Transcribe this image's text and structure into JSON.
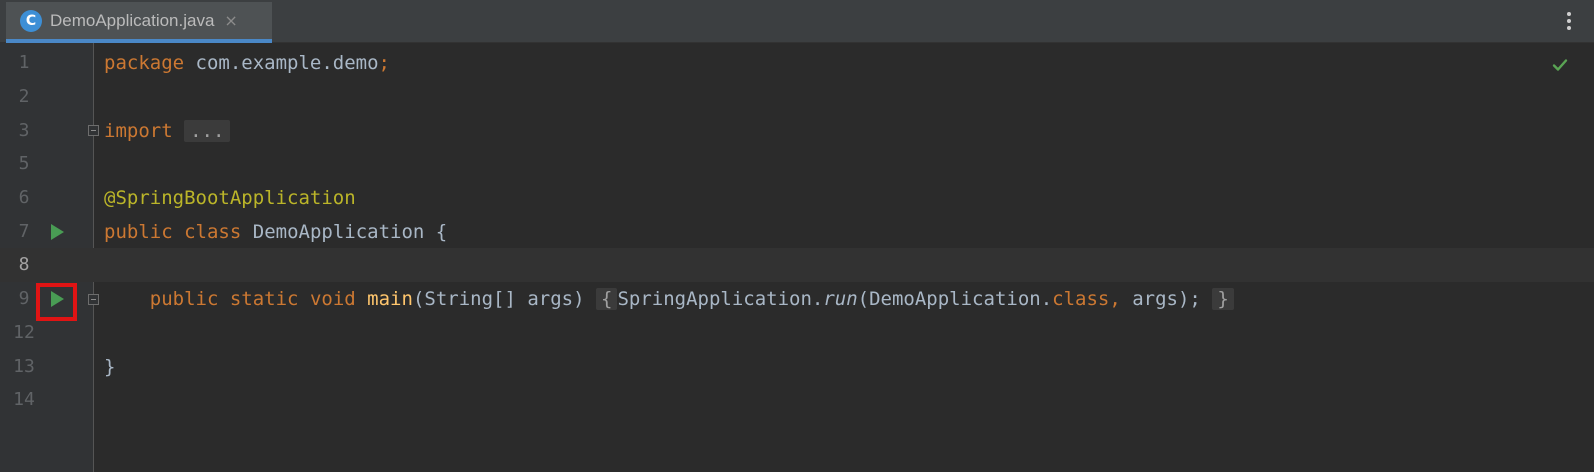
{
  "tab": {
    "title": "DemoApplication.java",
    "close_glyph": "×",
    "icon_letter": "C"
  },
  "lines": [
    {
      "number": "1",
      "active": false
    },
    {
      "number": "2",
      "active": false
    },
    {
      "number": "3",
      "active": false
    },
    {
      "number": "5",
      "active": false
    },
    {
      "number": "6",
      "active": false
    },
    {
      "number": "7",
      "active": false
    },
    {
      "number": "8",
      "active": true
    },
    {
      "number": "9",
      "active": false
    },
    {
      "number": "12",
      "active": false
    },
    {
      "number": "13",
      "active": false
    },
    {
      "number": "14",
      "active": false
    }
  ],
  "code": {
    "line1": {
      "kw": "package",
      "rest": " com.example.demo",
      "semi": ";"
    },
    "line3": {
      "kw": "import",
      "folded": "..."
    },
    "line6": {
      "annotation": "@SpringBootApplication"
    },
    "line7": {
      "kw1": "public",
      "kw2": "class",
      "name": "DemoApplication",
      "brace": "{"
    },
    "line9": {
      "kw1": "public",
      "kw2": "static",
      "kw3": "void",
      "method": "main",
      "params": "(String[] args)",
      "open_brace": "{",
      "call_target": "SpringApplication.",
      "call_method": "run",
      "arg1": "(DemoApplication.",
      "arg1_kw": "class",
      "comma": ",",
      "arg2": " args);",
      "close_brace": "}"
    },
    "line13": {
      "brace": "}"
    }
  },
  "colors": {
    "keyword": "#cc7832",
    "annotation": "#bbb529",
    "method": "#ffc66d",
    "text": "#a9b7c6",
    "run_icon": "#499c54",
    "highlight": "#e01414",
    "check": "#5aa454"
  },
  "icons": {
    "tab_icon": "java-class-icon",
    "run": "run-gutter-icon",
    "menu": "more-vertical-icon",
    "status": "checkmark-icon"
  }
}
